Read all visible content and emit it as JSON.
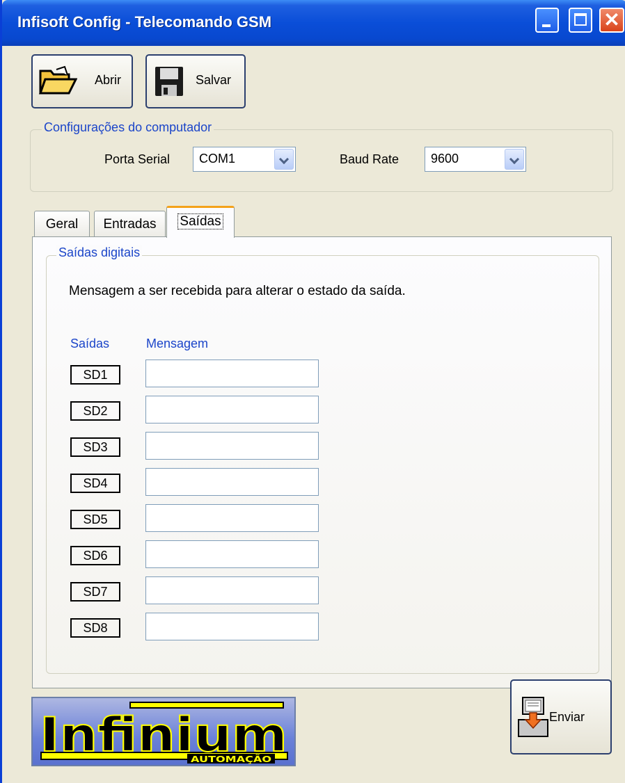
{
  "window": {
    "title": "Infisoft Config - Telecomando GSM"
  },
  "toolbar": {
    "open_label": "Abrir",
    "save_label": "Salvar"
  },
  "pc_config": {
    "legend": "Configurações do computador",
    "serial_port_label": "Porta Serial",
    "serial_port_value": "COM1",
    "baud_rate_label": "Baud Rate",
    "baud_rate_value": "9600"
  },
  "tabs": [
    {
      "label": "Geral",
      "active": false
    },
    {
      "label": "Entradas",
      "active": false
    },
    {
      "label": "Saídas",
      "active": true
    }
  ],
  "digital_outputs": {
    "legend": "Saídas digitais",
    "description": "Mensagem a ser recebida para alterar o estado da saída.",
    "col_outputs": "Saídas",
    "col_message": "Mensagem",
    "rows": [
      {
        "label": "SD1",
        "message": ""
      },
      {
        "label": "SD2",
        "message": ""
      },
      {
        "label": "SD3",
        "message": ""
      },
      {
        "label": "SD4",
        "message": ""
      },
      {
        "label": "SD5",
        "message": ""
      },
      {
        "label": "SD6",
        "message": ""
      },
      {
        "label": "SD7",
        "message": ""
      },
      {
        "label": "SD8",
        "message": ""
      }
    ]
  },
  "logo": {
    "name": "Infinium",
    "sub": "AUTOMAÇÃO"
  },
  "send_button": {
    "label": "Enviar"
  },
  "colors": {
    "title_bar": "#0a4ed8",
    "accent_text": "#1b45c9",
    "logo_yellow": "#ffff00",
    "logo_bg": "#6a81d8"
  },
  "icons": [
    "folder-open-icon",
    "floppy-disk-icon",
    "send-computer-icon",
    "minimize-icon",
    "maximize-icon",
    "close-icon"
  ]
}
